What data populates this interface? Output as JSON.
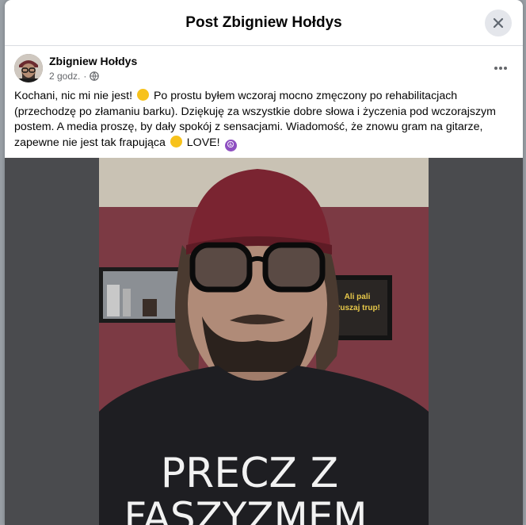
{
  "dialog": {
    "title": "Post Zbigniew Hołdys",
    "close_icon": "close-icon"
  },
  "post": {
    "author": "Zbigniew Hołdys",
    "time": "2 godz.",
    "separator": "·",
    "audience_icon": "globe-icon",
    "more_icon": "more-horizontal-icon",
    "text_part1": "Kochani, nic mi nie jest!",
    "text_part2": "Po prostu byłem wczoraj mocno zmęczony po rehabilitacjach (przechodzę po złamaniu barku). Dziękuję za wszystkie dobre słowa i życzenia pod wczorajszym postem. A media proszę, by dały spokój z sensacjami. Wiadomość, że znowu gram na gitarze, zapewne nie jest tak frapująca",
    "text_part3": "LOVE!",
    "emoji1": "slightly-smiling-face",
    "emoji2": "slightly-smiling-face",
    "emoji3": "peace-symbol"
  },
  "photo": {
    "shirt_text_line1": "PRECZ Z",
    "shirt_text_line2": "FASZYZMEM",
    "poster_text": "Ali pali Ruszaj trup!"
  },
  "colors": {
    "background": "#9aa0a6",
    "dialog": "#ffffff",
    "media_bg": "#4a4b4e",
    "wall": "#7c3a44",
    "cap": "#7a2431"
  }
}
